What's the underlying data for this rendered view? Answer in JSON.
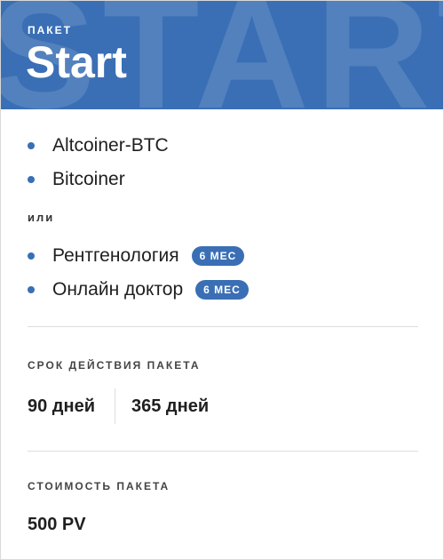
{
  "header": {
    "watermark": "START",
    "label": "ПАКЕТ",
    "title": "Start"
  },
  "group1": [
    {
      "label": "Altcoiner-BTC"
    },
    {
      "label": "Bitcoiner"
    }
  ],
  "or_label": "или",
  "group2": [
    {
      "label": "Рентгенология",
      "badge": "6 МЕС"
    },
    {
      "label": "Онлайн доктор",
      "badge": "6 МЕС"
    }
  ],
  "validity": {
    "label": "СРОК ДЕЙСТВИЯ ПАКЕТА",
    "options": [
      "90 дней",
      "365 дней"
    ]
  },
  "price": {
    "label": "СТОИМОСТЬ ПАКЕТА",
    "value": "500 PV"
  },
  "colors": {
    "accent": "#3a6fb5",
    "divider": "#dddddd"
  }
}
